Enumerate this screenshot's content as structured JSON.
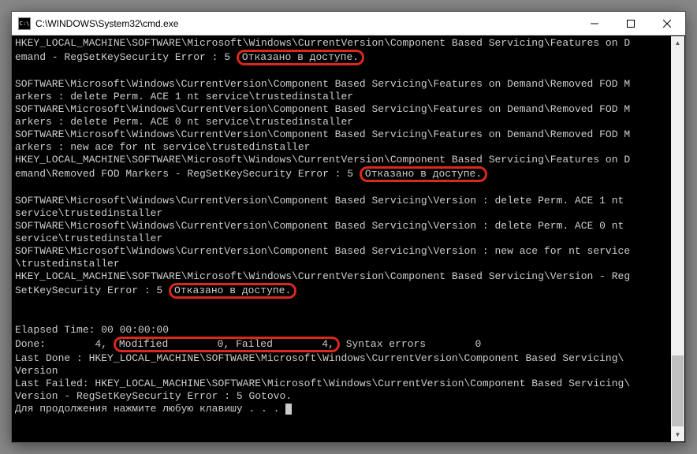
{
  "window": {
    "title": "C:\\WINDOWS\\System32\\cmd.exe"
  },
  "lines": {
    "l0a": "HKEY_LOCAL_MACHINE\\SOFTWARE\\Microsoft\\Windows\\CurrentVersion\\Component Based Servicing\\Features on D",
    "l0b": "emand - RegSetKeySecurity Error : 5",
    "err1": "Отказано в доступе.",
    "blank": "",
    "l1": "SOFTWARE\\Microsoft\\Windows\\CurrentVersion\\Component Based Servicing\\Features on Demand\\Removed FOD M",
    "l2": "arkers : delete Perm. ACE 1 nt service\\trustedinstaller",
    "l3": "SOFTWARE\\Microsoft\\Windows\\CurrentVersion\\Component Based Servicing\\Features on Demand\\Removed FOD M",
    "l4": "arkers : delete Perm. ACE 0 nt service\\trustedinstaller",
    "l5": "SOFTWARE\\Microsoft\\Windows\\CurrentVersion\\Component Based Servicing\\Features on Demand\\Removed FOD M",
    "l6": "arkers : new ace for nt service\\trustedinstaller",
    "l7": "HKEY_LOCAL_MACHINE\\SOFTWARE\\Microsoft\\Windows\\CurrentVersion\\Component Based Servicing\\Features on D",
    "l8": "emand\\Removed FOD Markers - RegSetKeySecurity Error : 5",
    "err2": "Отказано в доступе.",
    "l9": "SOFTWARE\\Microsoft\\Windows\\CurrentVersion\\Component Based Servicing\\Version : delete Perm. ACE 1 nt ",
    "l10": "service\\trustedinstaller",
    "l11": "SOFTWARE\\Microsoft\\Windows\\CurrentVersion\\Component Based Servicing\\Version : delete Perm. ACE 0 nt ",
    "l12": "service\\trustedinstaller",
    "l13": "SOFTWARE\\Microsoft\\Windows\\CurrentVersion\\Component Based Servicing\\Version : new ace for nt service",
    "l14": "\\trustedinstaller",
    "l15": "HKEY_LOCAL_MACHINE\\SOFTWARE\\Microsoft\\Windows\\CurrentVersion\\Component Based Servicing\\Version - Reg",
    "l16": "SetKeySecurity Error : 5",
    "err3": "Отказано в доступе.",
    "elapsed": "Elapsed Time: 00 00:00:00",
    "done_a": "Done:        4,",
    "done_mid": "Modified        0, Failed        4,",
    "done_b": " Syntax errors        0",
    "last1": "Last Done : HKEY_LOCAL_MACHINE\\SOFTWARE\\Microsoft\\Windows\\CurrentVersion\\Component Based Servicing\\",
    "last2": "Version",
    "lf1": "Last Failed: HKEY_LOCAL_MACHINE\\SOFTWARE\\Microsoft\\Windows\\CurrentVersion\\Component Based Servicing\\",
    "lf2": "Version - RegSetKeySecurity Error : 5 Gotovo.",
    "press": "Для продолжения нажмите любую клавишу . . . "
  }
}
